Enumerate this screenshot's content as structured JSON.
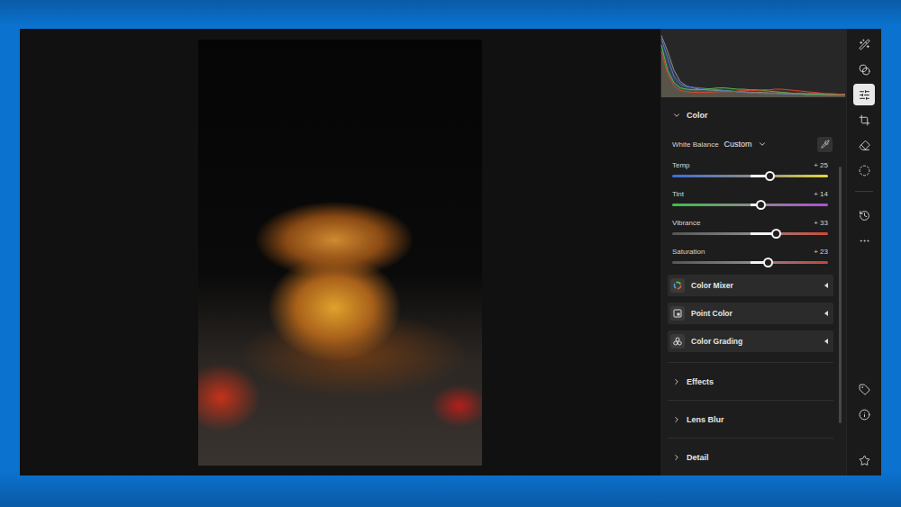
{
  "histogram": {
    "series": [
      {
        "name": "luminance",
        "color": "#8c8c8c",
        "values": [
          95,
          70,
          40,
          22,
          15,
          12,
          10,
          9,
          8,
          8,
          7,
          7,
          6,
          6,
          5,
          5,
          5,
          4,
          4,
          4,
          4,
          3,
          3,
          3,
          3,
          3,
          2,
          2,
          2,
          2
        ]
      },
      {
        "name": "blue",
        "color": "#4a78d8",
        "values": [
          90,
          60,
          30,
          18,
          14,
          13,
          12,
          11,
          10,
          9,
          8,
          7,
          6,
          5,
          4,
          4,
          3,
          3,
          3,
          2,
          2,
          2,
          2,
          1,
          1,
          1,
          1,
          1,
          1,
          1
        ]
      },
      {
        "name": "green",
        "color": "#4fbf4a",
        "values": [
          80,
          40,
          20,
          12,
          10,
          9,
          9,
          10,
          11,
          12,
          12,
          11,
          10,
          10,
          9,
          9,
          8,
          7,
          6,
          5,
          4,
          3,
          3,
          2,
          2,
          2,
          1,
          1,
          1,
          1
        ]
      },
      {
        "name": "red",
        "color": "#d8452f",
        "values": [
          70,
          35,
          15,
          8,
          6,
          5,
          5,
          5,
          5,
          6,
          6,
          6,
          7,
          8,
          8,
          8,
          9,
          9,
          10,
          10,
          9,
          8,
          7,
          6,
          5,
          4,
          3,
          3,
          2,
          1
        ]
      }
    ]
  },
  "color_section": {
    "title": "Color",
    "expanded": true,
    "white_balance": {
      "label": "White Balance",
      "value": "Custom"
    },
    "sliders": [
      {
        "label": "Temp",
        "reading": "+ 25",
        "level": 0.625,
        "color_from": "#3b6fd6",
        "color": "#e5d63b"
      },
      {
        "label": "Tint",
        "reading": "+ 14",
        "level": 0.57,
        "color_from": "#3fbf4a",
        "color": "#b04fd6"
      },
      {
        "label": "Vibrance",
        "reading": "+ 33",
        "level": 0.665,
        "color_from": "#555555",
        "color": "#d04a3a"
      },
      {
        "label": "Saturation",
        "reading": "+ 23",
        "level": 0.615,
        "color_from": "#555555",
        "color": "#c94040"
      }
    ],
    "subpanels": [
      {
        "label": "Color Mixer",
        "kind": "mixer",
        "expanded": false
      },
      {
        "label": "Point Color",
        "kind": "point",
        "expanded": false
      },
      {
        "label": "Color Grading",
        "kind": "grading",
        "expanded": false
      }
    ]
  },
  "sections": [
    {
      "title": "Effects",
      "expanded": false
    },
    {
      "title": "Lens Blur",
      "expanded": false
    },
    {
      "title": "Detail",
      "expanded": false
    }
  ],
  "toolbar": {
    "groups": [
      {
        "divider_after": true,
        "items": [
          {
            "kind": "auto",
            "selected": false
          },
          {
            "kind": "presets",
            "selected": false
          },
          {
            "kind": "edit",
            "selected": true
          },
          {
            "kind": "crop",
            "selected": false
          },
          {
            "kind": "remove",
            "selected": false
          },
          {
            "kind": "masking",
            "selected": false
          }
        ]
      },
      {
        "divider_after": false,
        "items": [
          {
            "kind": "history",
            "selected": false
          },
          {
            "kind": "more",
            "selected": false
          }
        ]
      },
      {
        "divider_after": false,
        "items": [
          {
            "kind": "keywords",
            "selected": false
          },
          {
            "kind": "info",
            "selected": false
          }
        ]
      },
      {
        "divider_after": false,
        "items": [
          {
            "kind": "rating",
            "selected": false
          }
        ]
      }
    ]
  }
}
